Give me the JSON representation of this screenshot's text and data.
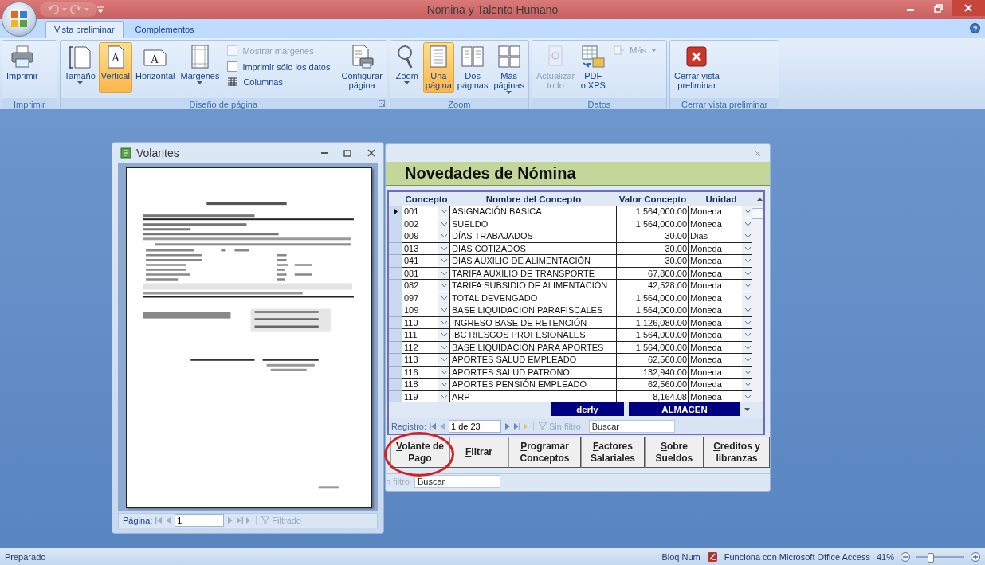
{
  "window": {
    "title": "Nomina y Talento Humano"
  },
  "ribbon": {
    "tabs": [
      {
        "label": "Vista preliminar",
        "selected": true
      },
      {
        "label": "Complementos",
        "selected": false
      }
    ],
    "help": "?",
    "groups": [
      {
        "label": "Imprimir",
        "launcher": false,
        "items": [
          {
            "kind": "large",
            "label": "Imprimir",
            "selected": false,
            "dropdown": false,
            "disabled": false
          }
        ]
      },
      {
        "label": "Diseño de página",
        "launcher": true,
        "items": [
          {
            "kind": "large",
            "label": "Tamaño",
            "selected": false,
            "dropdown": true,
            "disabled": false
          },
          {
            "kind": "large",
            "label": "Vertical",
            "glyph": "A",
            "selected": true,
            "dropdown": false,
            "disabled": false
          },
          {
            "kind": "large",
            "label": "Horizontal",
            "glyph": "A",
            "selected": false,
            "dropdown": false,
            "disabled": false
          },
          {
            "kind": "large",
            "label": "Márgenes",
            "selected": false,
            "dropdown": true,
            "disabled": false
          },
          {
            "kind": "stack",
            "items": [
              {
                "kind": "checkbox",
                "label": "Mostrar márgenes",
                "checked": false,
                "disabled": true
              },
              {
                "kind": "checkbox",
                "label": "Imprimir sólo los datos",
                "checked": false,
                "disabled": false
              },
              {
                "kind": "small",
                "label": "Columnas",
                "disabled": false,
                "dropdown": false
              }
            ]
          },
          {
            "kind": "large",
            "label": "Configurar\npágina",
            "selected": false,
            "dropdown": false,
            "disabled": false
          }
        ]
      },
      {
        "label": "Zoom",
        "launcher": false,
        "items": [
          {
            "kind": "large",
            "label": "Zoom",
            "selected": false,
            "dropdown": true,
            "disabled": false
          },
          {
            "kind": "large",
            "label": "Una\npágina",
            "selected": true,
            "dropdown": false,
            "disabled": false
          },
          {
            "kind": "large",
            "label": "Dos\npáginas",
            "selected": false,
            "dropdown": false,
            "disabled": false
          },
          {
            "kind": "large",
            "label": "Más\npáginas",
            "selected": false,
            "dropdown": true,
            "disabled": false
          }
        ]
      },
      {
        "label": "Datos",
        "launcher": false,
        "items": [
          {
            "kind": "large",
            "label": "Actualizar\ntodo",
            "selected": false,
            "dropdown": false,
            "disabled": true
          },
          {
            "kind": "large",
            "label": "PDF\no XPS",
            "selected": false,
            "dropdown": false,
            "disabled": false
          },
          {
            "kind": "stack",
            "items": [
              {
                "kind": "small",
                "label": "Más",
                "disabled": true,
                "dropdown": true
              }
            ]
          }
        ]
      },
      {
        "label": "Cerrar vista preliminar",
        "launcher": false,
        "items": [
          {
            "kind": "large",
            "label": "Cerrar vista\npreliminar",
            "selected": false,
            "dropdown": false,
            "disabled": false
          }
        ]
      }
    ]
  },
  "preview_window": {
    "title": "Volantes",
    "nav": {
      "label": "Página:",
      "page": "1",
      "filter": "Filtrado"
    }
  },
  "form": {
    "title": "Novedades de Nómina",
    "columns": [
      "Concepto",
      "Nombre del Concepto",
      "Valor Concepto",
      "Unidad"
    ],
    "rows": [
      {
        "code": "001",
        "name": "ASIGNACIÓN BASICA",
        "value": "1,564,000.00",
        "unit": "Moneda",
        "selected": true
      },
      {
        "code": "002",
        "name": "SUELDO",
        "value": "1,564,000.00",
        "unit": "Moneda",
        "selected": false
      },
      {
        "code": "009",
        "name": "DÍAS TRABAJADOS",
        "value": "30.00",
        "unit": "Dias",
        "selected": false
      },
      {
        "code": "013",
        "name": "DIAS COTIZADOS",
        "value": "30.00",
        "unit": "Moneda",
        "selected": false
      },
      {
        "code": "041",
        "name": "DIAS AUXILIO DE ALIMENTACIÓN",
        "value": "30.00",
        "unit": "Moneda",
        "selected": false
      },
      {
        "code": "081",
        "name": "TARIFA AUXILIO DE TRANSPORTE",
        "value": "67,800.00",
        "unit": "Moneda",
        "selected": false
      },
      {
        "code": "082",
        "name": "TARIFA SUBSIDIO DE ALIMENTACIÓN",
        "value": "42,528.00",
        "unit": "Moneda",
        "selected": false
      },
      {
        "code": "097",
        "name": "TOTAL DEVENGADO",
        "value": "1,564,000.00",
        "unit": "Moneda",
        "selected": false
      },
      {
        "code": "109",
        "name": "BASE LIQUIDACION PARAFISCALES",
        "value": "1,564,000.00",
        "unit": "Moneda",
        "selected": false
      },
      {
        "code": "110",
        "name": "INGRESO BASE DE RETENCIÓN",
        "value": "1,126,080.00",
        "unit": "Moneda",
        "selected": false
      },
      {
        "code": "111",
        "name": "IBC RIESGOS PROFESIONALES",
        "value": "1,564,000.00",
        "unit": "Moneda",
        "selected": false
      },
      {
        "code": "112",
        "name": "BASE LIQUIDACIÓN PARA APORTES",
        "value": "1,564,000.00",
        "unit": "Moneda",
        "selected": false
      },
      {
        "code": "113",
        "name": "APORTES SALUD EMPLEADO",
        "value": "62,560.00",
        "unit": "Moneda",
        "selected": false
      },
      {
        "code": "116",
        "name": "APORTES SALUD PATRONO",
        "value": "132,940.00",
        "unit": "Moneda",
        "selected": false
      },
      {
        "code": "118",
        "name": "APORTES PENSIÓN EMPLEADO",
        "value": "62,560.00",
        "unit": "Moneda",
        "selected": false
      },
      {
        "code": "119",
        "name": "ARP",
        "value": "8,164.08",
        "unit": "Moneda",
        "selected": false
      }
    ],
    "footer": [
      "derly",
      "ALMACEN"
    ],
    "nav": {
      "label": "Registro:",
      "record": "1 de 23",
      "filter": "Sin filtro",
      "placeholder": "Buscar"
    },
    "buttons": [
      "Volante de Pago",
      "Filtrar",
      "Programar Conceptos",
      "Factores Salariales",
      "Sobre Sueldos",
      "Creditos y libranzas"
    ],
    "back_nav": {
      "filter": "n filtro",
      "placeholder": "Buscar"
    }
  },
  "status_bar": {
    "left": "Preparado",
    "num_lock": "Bloq Num",
    "powered_by": "Funciona con Microsoft Office Access",
    "zoom": "41%",
    "level": 0.3
  }
}
